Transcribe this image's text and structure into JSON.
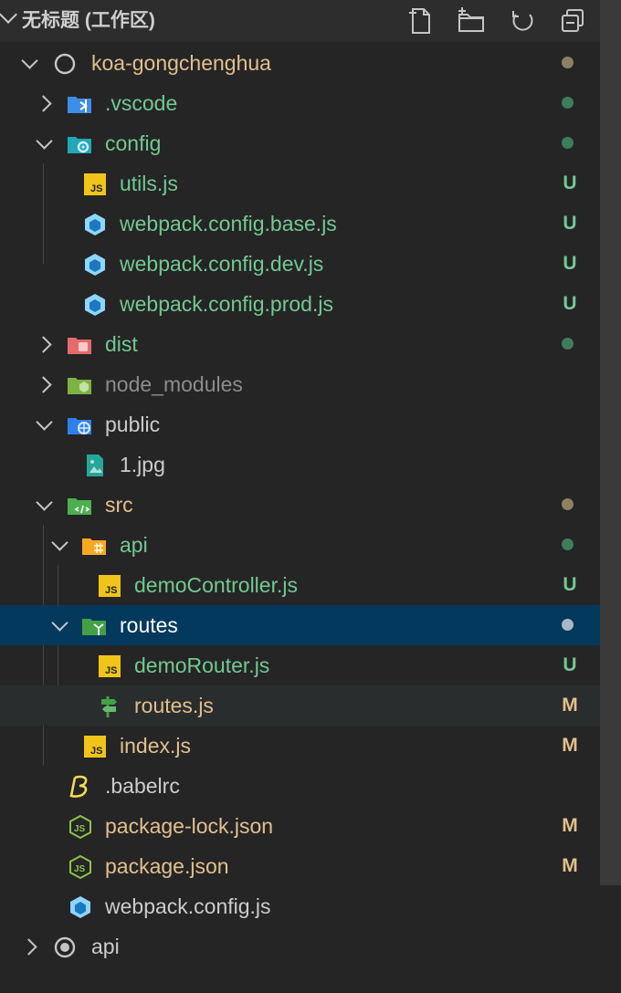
{
  "header": {
    "title": "无标题 (工作区)",
    "actions": [
      {
        "icon": "new-file-icon"
      },
      {
        "icon": "new-folder-icon"
      },
      {
        "icon": "refresh-icon"
      },
      {
        "icon": "collapse-all-icon"
      }
    ]
  },
  "colors": {
    "untracked": "#73c991",
    "modified": "#e2c08d",
    "ignored": "#8c8c8c",
    "default": "#cccccc",
    "selected_bg": "#04395e"
  },
  "tree": [
    {
      "name": "koa-gongchenghua",
      "type": "root",
      "status": "",
      "dot": "#8d8161"
    },
    {
      "name": ".vscode",
      "type": "folder",
      "status": "",
      "dot": "#3e7d5a"
    },
    {
      "name": "config",
      "type": "folder",
      "status": "",
      "dot": "#3e7d5a"
    },
    {
      "name": "utils.js",
      "type": "file",
      "status": "U"
    },
    {
      "name": "webpack.config.base.js",
      "type": "file",
      "status": "U"
    },
    {
      "name": "webpack.config.dev.js",
      "type": "file",
      "status": "U"
    },
    {
      "name": "webpack.config.prod.js",
      "type": "file",
      "status": "U"
    },
    {
      "name": "dist",
      "type": "folder",
      "status": "",
      "dot": "#3e7d5a"
    },
    {
      "name": "node_modules",
      "type": "folder",
      "status": ""
    },
    {
      "name": "public",
      "type": "folder",
      "status": ""
    },
    {
      "name": "1.jpg",
      "type": "file",
      "status": ""
    },
    {
      "name": "src",
      "type": "folder",
      "status": "",
      "dot": "#8d8161"
    },
    {
      "name": "api",
      "type": "folder",
      "status": "",
      "dot": "#3e7d5a"
    },
    {
      "name": "demoController.js",
      "type": "file",
      "status": "U"
    },
    {
      "name": "routes",
      "type": "folder",
      "status": "",
      "dot": "#a8b8c8"
    },
    {
      "name": "demoRouter.js",
      "type": "file",
      "status": "U"
    },
    {
      "name": "routes.js",
      "type": "file",
      "status": "M"
    },
    {
      "name": "index.js",
      "type": "file",
      "status": "M"
    },
    {
      "name": ".babelrc",
      "type": "file",
      "status": ""
    },
    {
      "name": "package-lock.json",
      "type": "file",
      "status": "M"
    },
    {
      "name": "package.json",
      "type": "file",
      "status": "M"
    },
    {
      "name": "webpack.config.js",
      "type": "file",
      "status": ""
    },
    {
      "name": "api",
      "type": "root",
      "status": ""
    }
  ]
}
